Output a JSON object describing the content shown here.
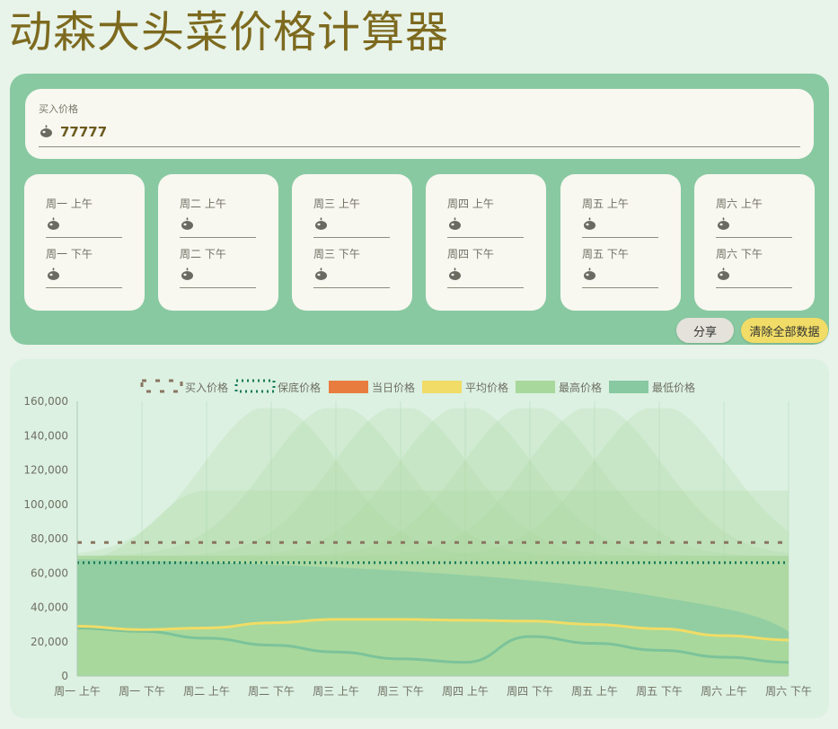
{
  "title": "动森大头菜价格计算器",
  "buy": {
    "label": "买入价格",
    "value": "77777"
  },
  "days": [
    {
      "am": "周一 上午",
      "pm": "周一 下午"
    },
    {
      "am": "周二 上午",
      "pm": "周二 下午"
    },
    {
      "am": "周三 上午",
      "pm": "周三 下午"
    },
    {
      "am": "周四 上午",
      "pm": "周四 下午"
    },
    {
      "am": "周五 上午",
      "pm": "周五 下午"
    },
    {
      "am": "周六 上午",
      "pm": "周六 下午"
    }
  ],
  "buttons": {
    "share": "分享",
    "clear": "清除全部数据"
  },
  "colors": {
    "buy": "#8a7560",
    "guarantee": "#1a7a5a",
    "today": "#e87c3e",
    "average": "#f0dc66",
    "max": "#a8d89c",
    "min": "#88c9a1",
    "panel": "#88c9a1"
  },
  "chart_data": {
    "type": "area",
    "legend": [
      "买入价格",
      "保底价格",
      "当日价格",
      "平均价格",
      "最高价格",
      "最低价格"
    ],
    "categories": [
      "周一 上午",
      "周一 下午",
      "周二 上午",
      "周二 下午",
      "周三 上午",
      "周三 下午",
      "周四 上午",
      "周四 下午",
      "周五 上午",
      "周五 下午",
      "周六 上午",
      "周六 下午"
    ],
    "yticks": [
      "0",
      "20,000",
      "40,000",
      "60,000",
      "80,000",
      "100,000",
      "120,000",
      "140,000",
      "160,000"
    ],
    "ylim": [
      0,
      160000
    ],
    "series": [
      {
        "name": "买入价格",
        "values": [
          77777,
          77777,
          77777,
          77777,
          77777,
          77777,
          77777,
          77777,
          77777,
          77777,
          77777,
          77777
        ]
      },
      {
        "name": "保底价格",
        "values": [
          66000,
          66000,
          66000,
          66000,
          66000,
          66000,
          66000,
          66000,
          66000,
          66000,
          66000,
          66000
        ]
      },
      {
        "name": "平均价格",
        "values": [
          29000,
          27000,
          28000,
          31000,
          33000,
          33000,
          32500,
          32000,
          30000,
          27500,
          23500,
          21000
        ]
      },
      {
        "name": "最低价格",
        "values": [
          28000,
          26000,
          22000,
          18000,
          14000,
          10000,
          8000,
          23000,
          19000,
          15000,
          11000,
          8000
        ]
      }
    ]
  }
}
